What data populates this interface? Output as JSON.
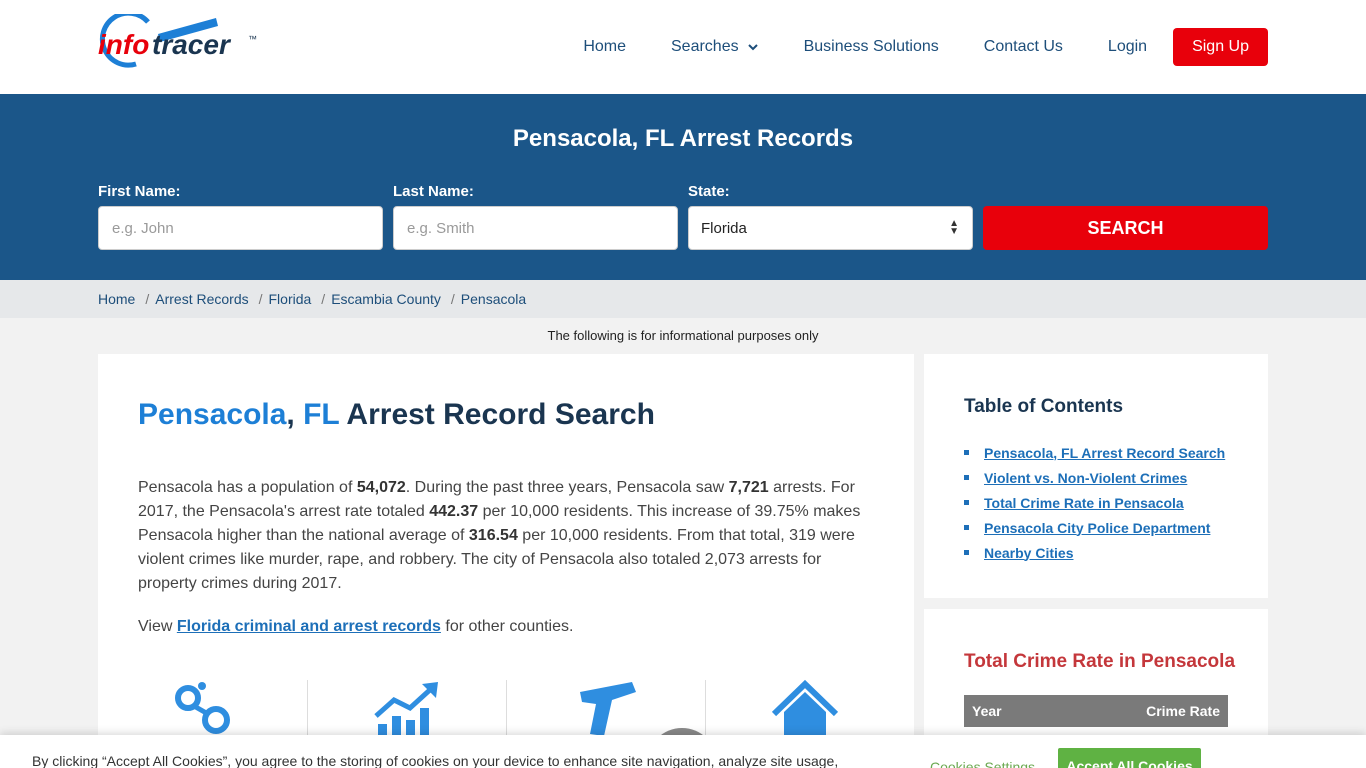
{
  "brand": {
    "logo_info": "info",
    "logo_tracer": "tracer",
    "logo_tm": "™"
  },
  "nav": {
    "home": "Home",
    "searches": "Searches",
    "business": "Business Solutions",
    "contact": "Contact Us",
    "login": "Login",
    "signup": "Sign Up"
  },
  "hero": {
    "title": "Pensacola, FL Arrest Records",
    "first_label": "First Name:",
    "first_placeholder": "e.g. John",
    "last_label": "Last Name:",
    "last_placeholder": "e.g. Smith",
    "state_label": "State:",
    "state_value": "Florida",
    "search_label": "SEARCH"
  },
  "breadcrumb": [
    "Home",
    "Arrest Records",
    "Florida",
    "Escambia County",
    "Pensacola"
  ],
  "info_note": "The following is for informational purposes only",
  "main": {
    "title_city": "Pensacola",
    "title_comma": ", ",
    "title_state": "FL",
    "title_rest": " Arrest Record Search",
    "p1": "Pensacola has a population of ",
    "population": "54,072",
    "p2": ". During the past three years, Pensacola saw ",
    "arrests": "7,721",
    "p3": " arrests. For 2017, the Pensacola's arrest rate totaled ",
    "rate": "442.37",
    "p4": " per 10,000 residents. This increase of 39.75% makes Pensacola higher than the national average of ",
    "national": "316.54",
    "p5": " per 10,000 residents. From that total, 319 were violent crimes like murder, rape, and robbery. The city of Pensacola also totaled 2,073 arrests for property crimes during 2017.",
    "view_prefix": "View ",
    "view_link": "Florida criminal and arrest records",
    "view_suffix": " for other counties."
  },
  "toc": {
    "title": "Table of Contents",
    "items": [
      "Pensacola, FL Arrest Record Search",
      "Violent vs. Non-Violent Crimes",
      "Total Crime Rate in Pensacola",
      "Pensacola City Police Department",
      "Nearby Cities"
    ]
  },
  "rate_card": {
    "title": "Total Crime Rate in Pensacola",
    "col_year": "Year",
    "col_rate": "Crime Rate"
  },
  "cookie": {
    "text": "By clicking “Accept All Cookies”, you agree to the storing of cookies on your device to enhance site navigation, analyze site usage,",
    "settings": "Cookies Settings",
    "accept": "Accept All Cookies"
  },
  "icons": [
    "handcuffs-icon",
    "chart-up-icon",
    "gun-icon",
    "house-icon"
  ],
  "colors": {
    "brand_blue": "#1b5689",
    "accent_red": "#e8000b",
    "link_blue": "#1d6fb8",
    "accept_green": "#5fb243"
  }
}
